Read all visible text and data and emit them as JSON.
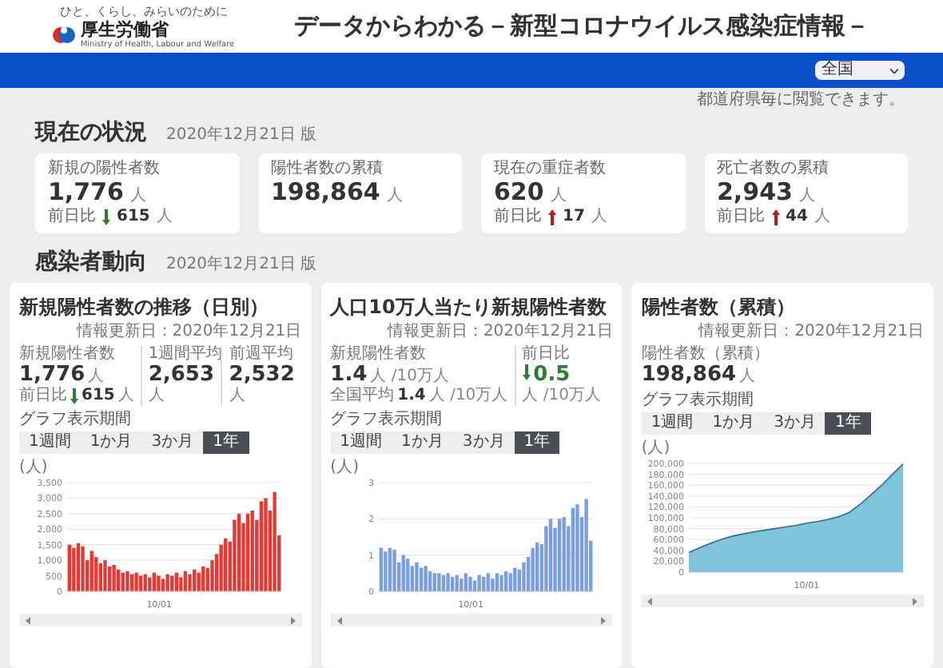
{
  "header": {
    "tagline": "ひと、くらし、みらいのために",
    "logo_text": "厚生労働省",
    "logo_subtext": "Ministry of Health, Labour and Welfare",
    "title": "データからわかる－新型コロナウイルス感染症情報－"
  },
  "region_select": {
    "value": "全国"
  },
  "note": "都道府県毎に閲覧できます。",
  "current": {
    "title": "現在の状況",
    "date": "2020年12月21日 版",
    "cards": [
      {
        "label": "新規の陽性者数",
        "value": "1,776",
        "unit": "人",
        "change": {
          "label": "前日比",
          "increased": false,
          "value": "615",
          "unit": "人"
        }
      },
      {
        "label": "陽性者数の累積",
        "value": "198,864",
        "unit": "人"
      },
      {
        "label": "現在の重症者数",
        "value": "620",
        "unit": "人",
        "change": {
          "label": "前日比",
          "increased": true,
          "value": "17",
          "unit": "人"
        }
      },
      {
        "label": "死亡者数の累積",
        "value": "2,943",
        "unit": "人",
        "change": {
          "label": "前日比",
          "increased": true,
          "value": "44",
          "unit": "人"
        }
      }
    ]
  },
  "trend": {
    "title": "感染者動向",
    "date": "2020年12月21日 版",
    "panels": [
      {
        "title": "新規陽性者数の推移（日別）",
        "updated": "情報更新日：2020年12月21日",
        "stats": [
          {
            "label": "新規陽性者数",
            "value": "1,776",
            "unit": "人",
            "change": {
              "label": "前日比",
              "increased": false,
              "value": "615",
              "unit": "人"
            }
          },
          {
            "label": "1週間平均",
            "value": "2,653",
            "unit": "人"
          },
          {
            "label": "前週平均",
            "value": "2,532",
            "unit": "人"
          }
        ],
        "range_label": "グラフ表示期間",
        "ranges": [
          {
            "label": "1週間",
            "selected": false
          },
          {
            "label": "1か月",
            "selected": false
          },
          {
            "label": "3か月",
            "selected": false
          },
          {
            "label": "1年",
            "selected": true
          }
        ],
        "chart_data": {
          "type": "bar",
          "ylabel": "(人)",
          "ylim": [
            0,
            3500
          ],
          "yticks": [
            {
              "value": 0,
              "label": "0"
            },
            {
              "value": 500,
              "label": "500"
            },
            {
              "value": 1000,
              "label": "1,000"
            },
            {
              "value": 1500,
              "label": "1,500"
            },
            {
              "value": 2000,
              "label": "2,000"
            },
            {
              "value": 2500,
              "label": "2,500"
            },
            {
              "value": 3000,
              "label": "3,000"
            },
            {
              "value": 3500,
              "label": "3,500"
            }
          ],
          "grid": true,
          "annotations": [
            "10/01"
          ],
          "series": [
            {
              "color": "#e53935",
              "values": [
                1500,
                1400,
                1550,
                1450,
                1000,
                1300,
                1100,
                900,
                1000,
                800,
                850,
                700,
                600,
                650,
                550,
                600,
                500,
                550,
                450,
                600,
                500,
                400,
                550,
                500,
                600,
                450,
                650,
                550,
                700,
                600,
                800,
                750,
                1000,
                1200,
                1500,
                1700,
                1600,
                2300,
                2500,
                2200,
                2500,
                2600,
                2300,
                2900,
                3000,
                2600,
                3200,
                1800
              ]
            }
          ]
        }
      },
      {
        "title": "人口10万人当たり新規陽性者数",
        "updated": "情報更新日：2020年12月21日",
        "stats": [
          {
            "label": "新規陽性者数",
            "value": "1.4",
            "unit": "人 /10万人",
            "sub": {
              "label": "全国平均",
              "value": "1.4",
              "unit": "人 /10万人"
            }
          },
          {
            "label": "前日比",
            "value": "0.5",
            "unit": "人 /10万人",
            "increased": false
          }
        ],
        "range_label": "グラフ表示期間",
        "ranges": [
          {
            "label": "1週間",
            "selected": false
          },
          {
            "label": "1か月",
            "selected": false
          },
          {
            "label": "3か月",
            "selected": false
          },
          {
            "label": "1年",
            "selected": true
          }
        ],
        "chart_data": {
          "type": "bar",
          "ylabel": "(人)",
          "ylim": [
            0,
            3
          ],
          "yticks": [
            {
              "value": 0,
              "label": "0"
            },
            {
              "value": 1,
              "label": "1"
            },
            {
              "value": 2,
              "label": "2"
            },
            {
              "value": 3,
              "label": "3"
            }
          ],
          "grid": true,
          "annotations": [
            "10/01"
          ],
          "series": [
            {
              "color": "#7b9ee0",
              "values": [
                1.2,
                1.1,
                1.2,
                1.15,
                0.8,
                1.0,
                0.9,
                0.7,
                0.8,
                0.65,
                0.7,
                0.55,
                0.5,
                0.5,
                0.45,
                0.5,
                0.4,
                0.45,
                0.35,
                0.5,
                0.4,
                0.3,
                0.45,
                0.4,
                0.5,
                0.35,
                0.5,
                0.45,
                0.55,
                0.5,
                0.65,
                0.6,
                0.8,
                0.95,
                1.2,
                1.35,
                1.3,
                1.8,
                2.0,
                1.75,
                2.0,
                2.05,
                1.8,
                2.3,
                2.4,
                2.05,
                2.55,
                1.4
              ]
            }
          ]
        }
      },
      {
        "title": "陽性者数（累積）",
        "updated": "情報更新日：2020年12月21日",
        "stats": [
          {
            "label": "陽性者数（累積）",
            "value": "198,864",
            "unit": "人"
          }
        ],
        "range_label": "グラフ表示期間",
        "ranges": [
          {
            "label": "1週間",
            "selected": false
          },
          {
            "label": "1か月",
            "selected": false
          },
          {
            "label": "3か月",
            "selected": false
          },
          {
            "label": "1年",
            "selected": true
          }
        ],
        "chart_data": {
          "type": "area",
          "ylabel": "(人)",
          "ylim": [
            0,
            200000
          ],
          "yticks": [
            {
              "value": 0,
              "label": "0"
            },
            {
              "value": 20000,
              "label": "20,000"
            },
            {
              "value": 40000,
              "label": "40,000"
            },
            {
              "value": 60000,
              "label": "60,000"
            },
            {
              "value": 80000,
              "label": "80,000"
            },
            {
              "value": 100000,
              "label": "100,000"
            },
            {
              "value": 120000,
              "label": "120,000"
            },
            {
              "value": 140000,
              "label": "140,000"
            },
            {
              "value": 160000,
              "label": "160,000"
            },
            {
              "value": 180000,
              "label": "180,000"
            },
            {
              "value": 200000,
              "label": "200,000"
            }
          ],
          "grid": true,
          "annotations": [
            "10/01"
          ],
          "series": [
            {
              "color": "#7fc4dc",
              "values": [
                36000,
                45000,
                53000,
                60000,
                66000,
                70000,
                74000,
                77000,
                80000,
                83000,
                86000,
                90000,
                93000,
                97000,
                102000,
                110000,
                125000,
                142000,
                160000,
                180000,
                199000
              ]
            }
          ]
        }
      }
    ]
  }
}
